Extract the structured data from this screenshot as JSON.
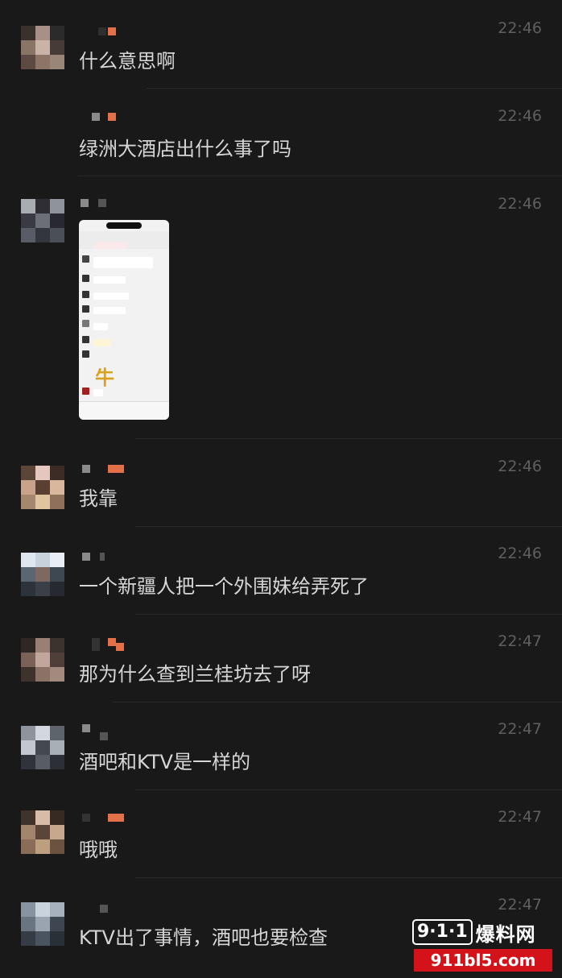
{
  "messages": [
    {
      "time": "22:46",
      "text": "什么意思啊"
    },
    {
      "time": "22:46",
      "text": "绿洲大酒店出什么事了吗"
    },
    {
      "time": "22:46",
      "text": ""
    },
    {
      "time": "22:46",
      "text": "我靠"
    },
    {
      "time": "22:46",
      "text": "一个新疆人把一个外围妹给弄死了"
    },
    {
      "time": "22:47",
      "text": "那为什么查到兰桂坊去了呀"
    },
    {
      "time": "22:47",
      "text": "酒吧和KTV是一样的"
    },
    {
      "time": "22:47",
      "text": "哦哦"
    },
    {
      "time": "22:47",
      "text": "KTV出了事情，酒吧也要检查"
    }
  ],
  "shared_image": {
    "kind": "chat-screenshot",
    "big_glyph": "牛"
  },
  "watermark": {
    "box_text": "9·1·1",
    "brand": "爆料网",
    "url": "911bl5.com"
  },
  "colors": {
    "background": "#191919",
    "text": "#d6d6d6",
    "time": "#5f5f5f",
    "watermark_red": "#d4121a"
  }
}
